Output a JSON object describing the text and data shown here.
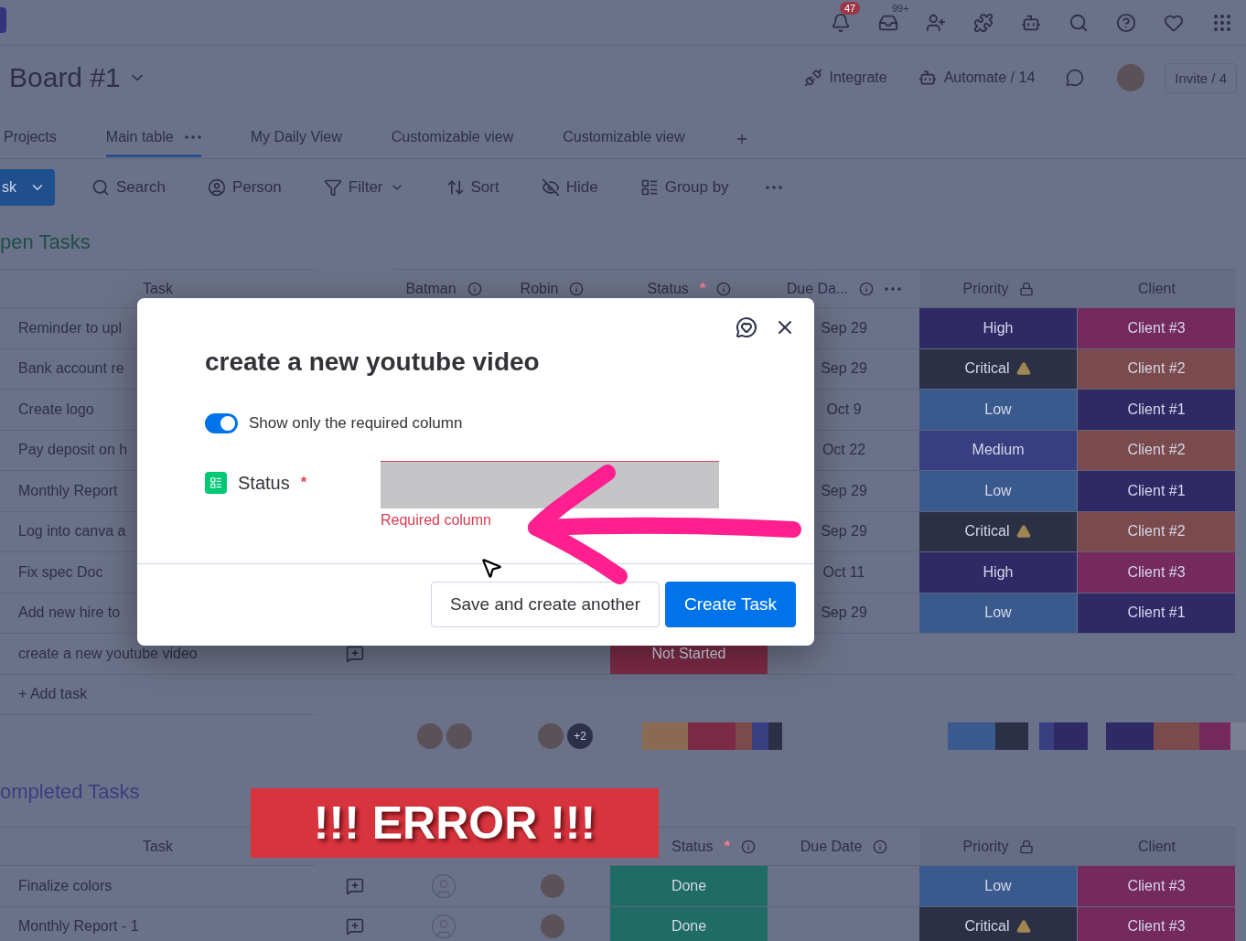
{
  "topbar": {
    "notifications_badge": "47",
    "inbox_badge": "99+"
  },
  "board": {
    "title": "Board #1",
    "integrate": "Integrate",
    "automate": "Automate / 14",
    "invite": "Invite / 4"
  },
  "tabs": [
    {
      "label": "Projects",
      "selected": false
    },
    {
      "label": "Main table",
      "selected": true
    },
    {
      "label": "My Daily View",
      "selected": false
    },
    {
      "label": "Customizable view",
      "selected": false
    },
    {
      "label": "Customizable view",
      "selected": false
    }
  ],
  "toolbar": {
    "new_item": "sk",
    "items": [
      {
        "kind": "search",
        "label": "Search"
      },
      {
        "kind": "person",
        "label": "Person"
      },
      {
        "kind": "filter",
        "label": "Filter"
      },
      {
        "kind": "sort",
        "label": "Sort"
      },
      {
        "kind": "hide",
        "label": "Hide"
      },
      {
        "kind": "group",
        "label": "Group by"
      }
    ]
  },
  "open_group": {
    "title": "pen Tasks",
    "columns": [
      "Task",
      "Batman",
      "Robin",
      "Status",
      "Due Da...",
      "Priority",
      "Client"
    ],
    "required_mark": "*",
    "rows": [
      {
        "task": "Reminder to upl",
        "due": "Sep 29",
        "priority": {
          "label": "High",
          "color": "#2f2a66"
        },
        "client": {
          "label": "Client #3",
          "color": "#74295f"
        }
      },
      {
        "task": "Bank account re",
        "due": "Sep 29",
        "priority": {
          "label": "Critical",
          "color": "#2c3046",
          "warning": true
        },
        "client": {
          "label": "Client #2",
          "color": "#7a4a4c"
        }
      },
      {
        "task": "Create logo",
        "due": "Oct 9",
        "priority": {
          "label": "Low",
          "color": "#3a5a8e"
        },
        "client": {
          "label": "Client #1",
          "color": "#2f2a66"
        }
      },
      {
        "task": "Pay deposit on h",
        "due": "Oct 22",
        "priority": {
          "label": "Medium",
          "color": "#383f80"
        },
        "client": {
          "label": "Client #2",
          "color": "#7a4a4c"
        }
      },
      {
        "task": "Monthly Report",
        "due": "Sep 29",
        "priority": {
          "label": "Low",
          "color": "#3a5a8e"
        },
        "client": {
          "label": "Client #1",
          "color": "#2f2a66"
        }
      },
      {
        "task": "Log into canva a",
        "due": "Sep 29",
        "priority": {
          "label": "Critical",
          "color": "#2c3046",
          "warning": true
        },
        "client": {
          "label": "Client #2",
          "color": "#7a4a4c"
        }
      },
      {
        "task": "Fix spec Doc",
        "due": "Oct 11",
        "priority": {
          "label": "High",
          "color": "#2f2a66"
        },
        "client": {
          "label": "Client #3",
          "color": "#74295f"
        }
      },
      {
        "task": "Add new hire to",
        "due": "Sep 29",
        "priority": {
          "label": "Low",
          "color": "#3a5a8e"
        },
        "client": {
          "label": "Client #1",
          "color": "#2f2a66"
        }
      },
      {
        "task": "create a new youtube video",
        "status": {
          "label": "Not Started",
          "color": "#7c2b46"
        }
      }
    ],
    "add_task": "+ Add task",
    "robin_more": "+2"
  },
  "completed_group": {
    "title": "ompleted Tasks",
    "columns": [
      "Task",
      "",
      "",
      "Status",
      "Due Date",
      "Priority",
      "Client"
    ],
    "required_mark": "*",
    "rows": [
      {
        "task": "Finalize colors",
        "status": {
          "label": "Done",
          "color": "#1f6b66"
        },
        "priority": {
          "label": "Low",
          "color": "#3a5a8e"
        },
        "client": {
          "label": "Client #3",
          "color": "#74295f"
        }
      },
      {
        "task": "Monthly Report - 1",
        "status": {
          "label": "Done",
          "color": "#1f6b66"
        },
        "priority": {
          "label": "Critical",
          "color": "#2c3046",
          "warning": true
        },
        "client": {
          "label": "Client #3",
          "color": "#74295f"
        }
      }
    ]
  },
  "modal": {
    "title": "create a new youtube video",
    "toggle": {
      "label": "Show only the required column",
      "on": true
    },
    "field": {
      "label": "Status",
      "required": "*",
      "error": "Required column"
    },
    "secondary_button": "Save and create another",
    "primary_button": "Create Task"
  },
  "banner": "!!! ERROR !!!"
}
